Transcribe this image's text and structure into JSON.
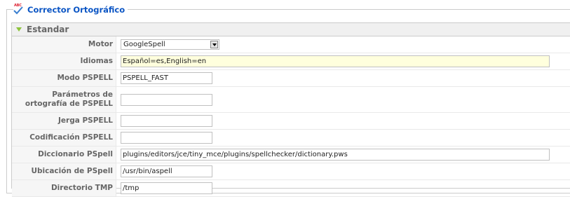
{
  "legend": {
    "title": "Corrector Ortográfico",
    "icon_text": "ABC"
  },
  "panel": {
    "title": "Estandar",
    "rows": [
      {
        "label": "Motor",
        "type": "select",
        "value": "GoogleSpell"
      },
      {
        "label": "Idiomas",
        "type": "text",
        "value": "Español=es,English=en"
      },
      {
        "label": "Modo PSPELL",
        "type": "text",
        "value": "PSPELL_FAST"
      },
      {
        "label": "Parámetros de ortografía de PSPELL",
        "type": "text",
        "value": ""
      },
      {
        "label": "Jerga PSPELL",
        "type": "text",
        "value": ""
      },
      {
        "label": "Codificación PSPELL",
        "type": "text",
        "value": ""
      },
      {
        "label": "Diccionario PSpell",
        "type": "text",
        "value": "plugins/editors/jce/tiny_mce/plugins/spellchecker/dictionary.pws"
      },
      {
        "label": "Ubicación de PSpell",
        "type": "text",
        "value": "/usr/bin/aspell"
      },
      {
        "label": "Directorio TMP",
        "type": "text",
        "value": "/tmp"
      }
    ]
  },
  "colors": {
    "legend_title": "#0b55c4",
    "toggle_arrow": "#8dc43c",
    "highlight_field": "#ffffdd"
  }
}
